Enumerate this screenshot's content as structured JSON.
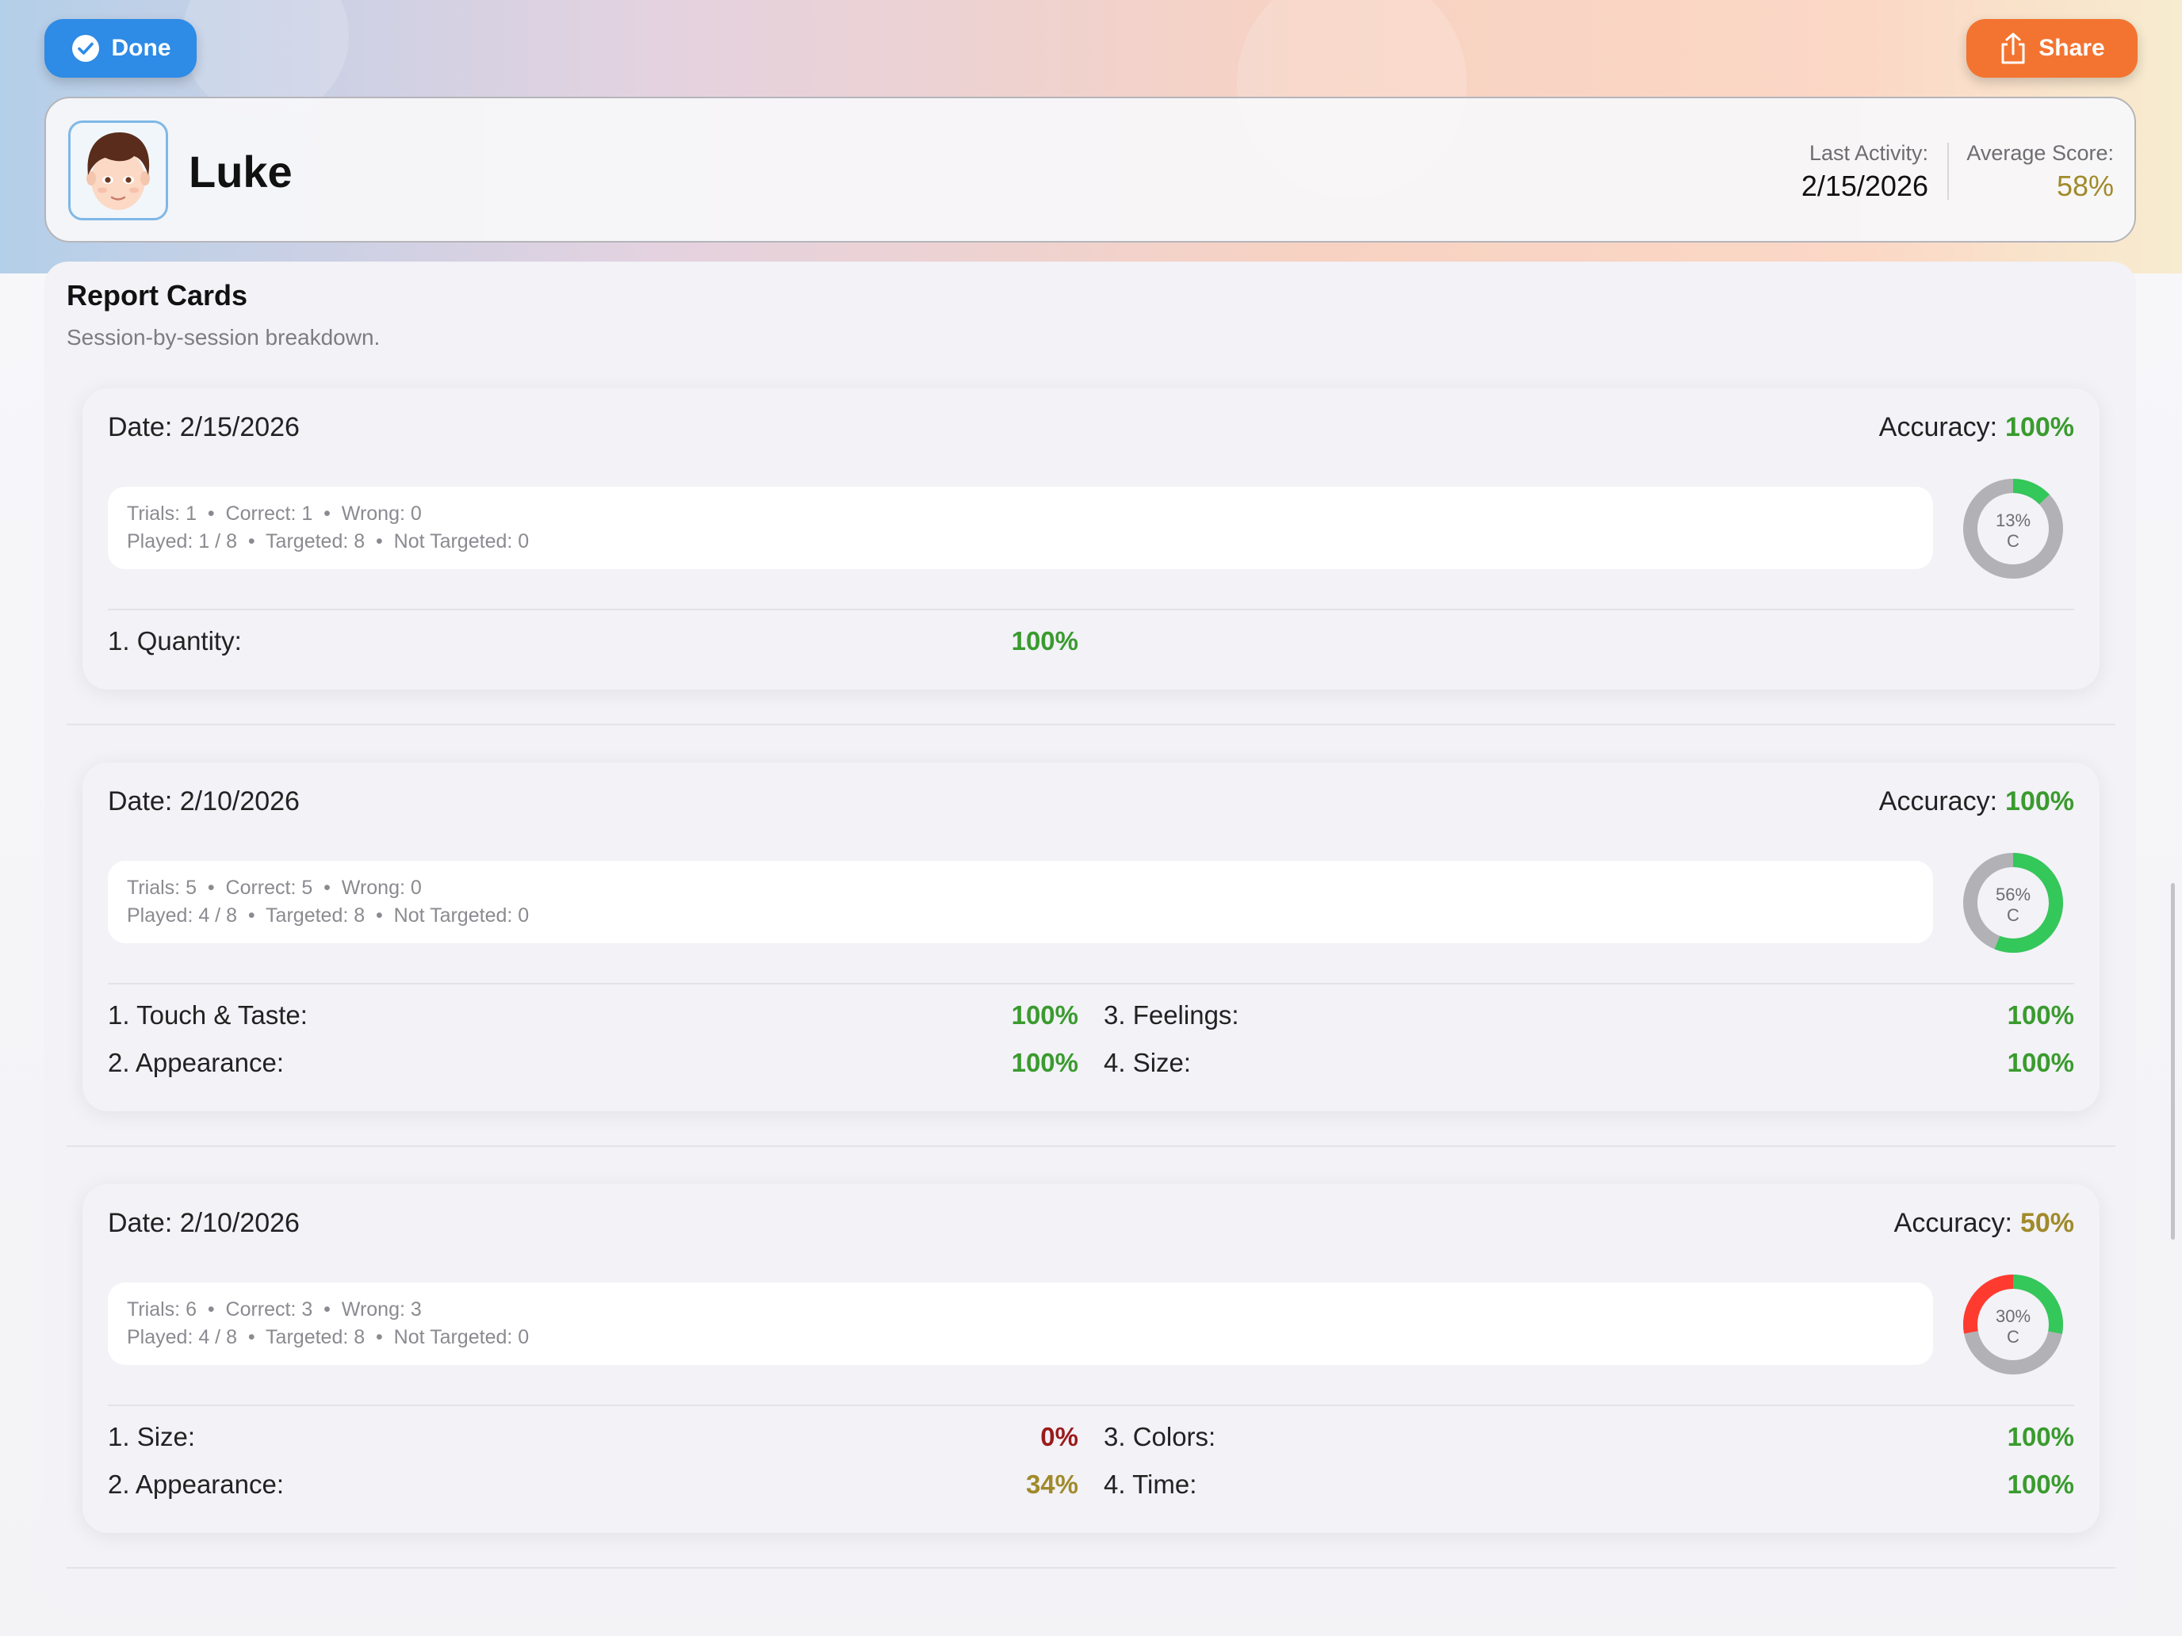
{
  "toolbar": {
    "done_label": "Done",
    "share_label": "Share"
  },
  "colors": {
    "green": "#3a9b2e",
    "olive": "#a08a2a",
    "red": "#9b1b1b",
    "ring_gray": "#b2b2b6",
    "ring_green": "#34c759",
    "ring_red": "#ff3b30"
  },
  "profile": {
    "name": "Luke",
    "last_activity_label": "Last Activity:",
    "last_activity_value": "2/15/2026",
    "average_score_label": "Average Score:",
    "average_score_value": "58%"
  },
  "report": {
    "title": "Report Cards",
    "subtitle": "Session-by-session breakdown.",
    "cards": [
      {
        "date": "Date: 2/15/2026",
        "accuracy_label": "Accuracy:",
        "accuracy_value": "100%",
        "stats_line1": "Trials: 1  •  Correct: 1  •  Wrong: 0",
        "stats_line2": "Played: 1 / 8  •  Targeted: 8  •  Not Targeted: 0",
        "donut": {
          "percent_text": "13%",
          "grade": "C",
          "green": 0.13,
          "red": 0
        },
        "items": [
          {
            "label": "1. Quantity:",
            "value": "100%"
          }
        ]
      },
      {
        "date": "Date: 2/10/2026",
        "accuracy_label": "Accuracy:",
        "accuracy_value": "100%",
        "stats_line1": "Trials: 5  •  Correct: 5  •  Wrong: 0",
        "stats_line2": "Played: 4 / 8  •  Targeted: 8  •  Not Targeted: 0",
        "donut": {
          "percent_text": "56%",
          "grade": "C",
          "green": 0.56,
          "red": 0
        },
        "items": [
          {
            "label": "1. Touch & Taste:",
            "value": "100%"
          },
          {
            "label": "2. Appearance:",
            "value": "100%"
          },
          {
            "label": "3. Feelings:",
            "value": "100%"
          },
          {
            "label": "4. Size:",
            "value": "100%"
          }
        ]
      },
      {
        "date": "Date: 2/10/2026",
        "accuracy_label": "Accuracy:",
        "accuracy_value": "50%",
        "stats_line1": "Trials: 6  •  Correct: 3  •  Wrong: 3",
        "stats_line2": "Played: 4 / 8  •  Targeted: 8  •  Not Targeted: 0",
        "donut": {
          "percent_text": "30%",
          "grade": "C",
          "green": 0.28,
          "red": 0.28
        },
        "items": [
          {
            "label": "1. Size:",
            "value": "0%"
          },
          {
            "label": "2. Appearance:",
            "value": "34%"
          },
          {
            "label": "3. Colors:",
            "value": "100%"
          },
          {
            "label": "4. Time:",
            "value": "100%"
          }
        ]
      }
    ]
  }
}
